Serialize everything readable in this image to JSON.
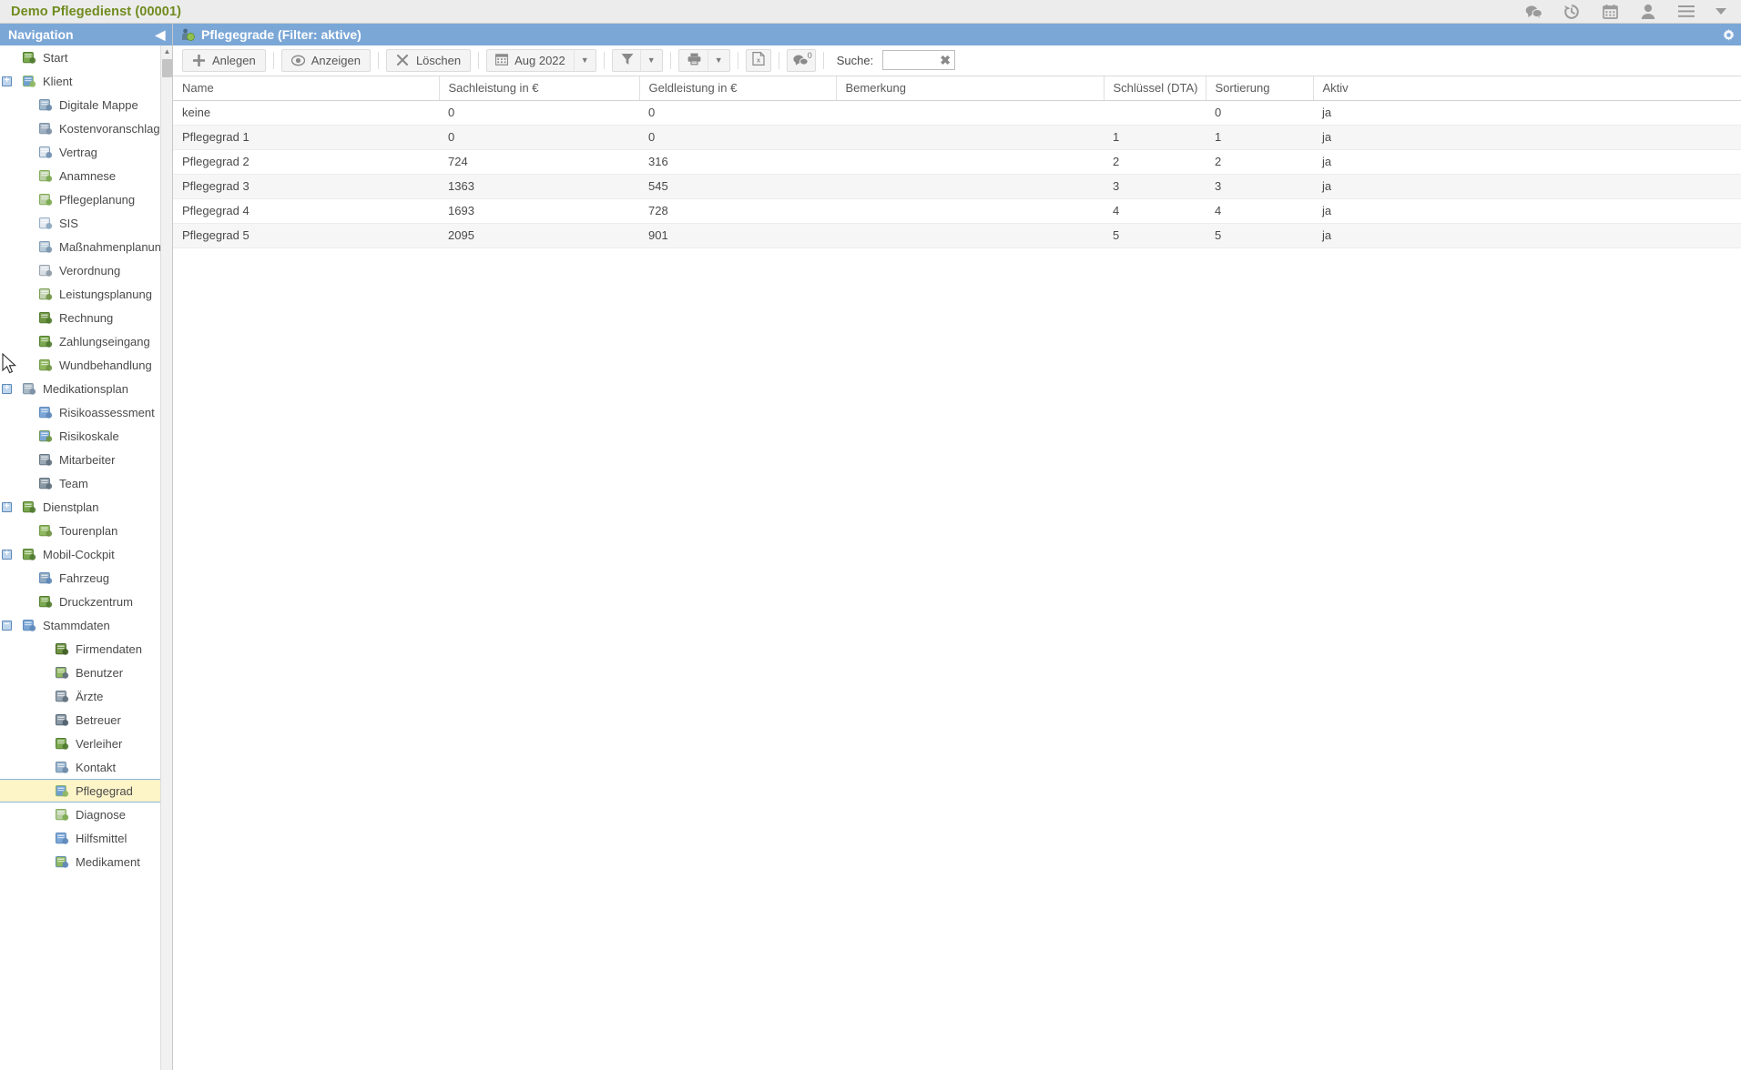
{
  "appbar": {
    "title": "Demo Pflegedienst (00001)",
    "icons": [
      {
        "name": "chat-icon",
        "glyph": "chat"
      },
      {
        "name": "history-icon",
        "glyph": "history"
      },
      {
        "name": "calendar-icon",
        "glyph": "calendar"
      },
      {
        "name": "user-icon",
        "glyph": "user"
      },
      {
        "name": "menu-icon",
        "glyph": "menu"
      },
      {
        "name": "dropdown-arrow-icon",
        "glyph": "caret"
      }
    ]
  },
  "sidebar": {
    "title": "Navigation",
    "collapse_glyph": "◀",
    "selected": "Pflegegrad",
    "items": [
      {
        "label": "Start",
        "indent": 0,
        "expander": "",
        "icon": "start-icon",
        "color": "#7aa84f",
        "color2": "#4f7a2f"
      },
      {
        "label": "Klient",
        "indent": 0,
        "expander": "+",
        "icon": "klient-icon",
        "color": "#6f9fd0",
        "color2": "#8fb85f"
      },
      {
        "label": "Digitale Mappe",
        "indent": 1,
        "expander": "",
        "icon": "digitale-mappe-icon",
        "color": "#9fb8cc",
        "color2": "#6b8aa8"
      },
      {
        "label": "Kostenvoranschlag",
        "indent": 1,
        "expander": "",
        "icon": "kostenvoranschlag-icon",
        "color": "#9fb0c0",
        "color2": "#7a8fa5"
      },
      {
        "label": "Vertrag",
        "indent": 1,
        "expander": "",
        "icon": "vertrag-icon",
        "color": "#dfe6ee",
        "color2": "#6f8fb0"
      },
      {
        "label": "Anamnese",
        "indent": 1,
        "expander": "",
        "icon": "anamnese-icon",
        "color": "#b9cfa3",
        "color2": "#7aa84f"
      },
      {
        "label": "Pflegeplanung",
        "indent": 1,
        "expander": "",
        "icon": "pflegeplanung-icon",
        "color": "#b9cfa3",
        "color2": "#7aa84f"
      },
      {
        "label": "SIS",
        "indent": 1,
        "expander": "",
        "icon": "sis-icon",
        "color": "#e4eaf0",
        "color2": "#8aa6bf"
      },
      {
        "label": "Maßnahmenplanung",
        "indent": 1,
        "expander": "",
        "icon": "massnahmenplanung-icon",
        "color": "#b6c9d8",
        "color2": "#7a96ae"
      },
      {
        "label": "Verordnung",
        "indent": 1,
        "expander": "",
        "icon": "verordnung-icon",
        "color": "#d8dee4",
        "color2": "#8c9aa6"
      },
      {
        "label": "Leistungsplanung",
        "indent": 1,
        "expander": "",
        "icon": "leistungsplanung-icon",
        "color": "#c3d3b3",
        "color2": "#6f9444"
      },
      {
        "label": "Rechnung",
        "indent": 1,
        "expander": "",
        "icon": "rechnung-icon",
        "color": "#6f9444",
        "color2": "#4f7a2f"
      },
      {
        "label": "Zahlungseingang",
        "indent": 1,
        "expander": "",
        "icon": "zahlungseingang-icon",
        "color": "#7aa84f",
        "color2": "#4f7a2f"
      },
      {
        "label": "Wundbehandlung",
        "indent": 1,
        "expander": "",
        "icon": "wundbehandlung-icon",
        "color": "#8fb85f",
        "color2": "#6f9444"
      },
      {
        "label": "Medikationsplan",
        "indent": 0,
        "expander": "+",
        "icon": "medikationsplan-icon",
        "color": "#a8b8c4",
        "color2": "#7a8fa5"
      },
      {
        "label": "Risikoassessment",
        "indent": 1,
        "expander": "",
        "icon": "risikoassessment-icon",
        "color": "#7ba7d7",
        "color2": "#5d87b8"
      },
      {
        "label": "Risikoskale",
        "indent": 1,
        "expander": "",
        "icon": "risikoskale-icon",
        "color": "#7ba7d7",
        "color2": "#6f9444"
      },
      {
        "label": "Mitarbeiter",
        "indent": 1,
        "expander": "",
        "icon": "mitarbeiter-icon",
        "color": "#9aa8b4",
        "color2": "#5f6f7c"
      },
      {
        "label": "Team",
        "indent": 1,
        "expander": "",
        "icon": "team-icon",
        "color": "#8a99a6",
        "color2": "#5f6f7c"
      },
      {
        "label": "Dienstplan",
        "indent": 0,
        "expander": "+",
        "icon": "dienstplan-icon",
        "color": "#7aa84f",
        "color2": "#4f7a2f"
      },
      {
        "label": "Tourenplan",
        "indent": 1,
        "expander": "",
        "icon": "tourenplan-icon",
        "color": "#8fb85f",
        "color2": "#6f9444"
      },
      {
        "label": "Mobil-Cockpit",
        "indent": 0,
        "expander": "+",
        "icon": "mobil-cockpit-icon",
        "color": "#7aa84f",
        "color2": "#4f7a2f"
      },
      {
        "label": "Fahrzeug",
        "indent": 1,
        "expander": "",
        "icon": "fahrzeug-icon",
        "color": "#8fa8c0",
        "color2": "#5d87b8"
      },
      {
        "label": "Druckzentrum",
        "indent": 1,
        "expander": "",
        "icon": "druckzentrum-icon",
        "color": "#7aa84f",
        "color2": "#4f7a2f"
      },
      {
        "label": "Stammdaten",
        "indent": 0,
        "expander": "−",
        "icon": "stammdaten-icon",
        "color": "#7ba7d7",
        "color2": "#5d87b8"
      },
      {
        "label": "Firmendaten",
        "indent": 2,
        "expander": "",
        "icon": "firmendaten-icon",
        "color": "#6f9444",
        "color2": "#3f5f24"
      },
      {
        "label": "Benutzer",
        "indent": 2,
        "expander": "",
        "icon": "benutzer-icon",
        "color": "#8fb85f",
        "color2": "#5f6f7c"
      },
      {
        "label": "Ärzte",
        "indent": 2,
        "expander": "",
        "icon": "aerzte-icon",
        "color": "#9aa8b4",
        "color2": "#5f6f7c"
      },
      {
        "label": "Betreuer",
        "indent": 2,
        "expander": "",
        "icon": "betreuer-icon",
        "color": "#8a99a6",
        "color2": "#4f5f6c"
      },
      {
        "label": "Verleiher",
        "indent": 2,
        "expander": "",
        "icon": "verleiher-icon",
        "color": "#7aa84f",
        "color2": "#4f7a2f"
      },
      {
        "label": "Kontakt",
        "indent": 2,
        "expander": "",
        "icon": "kontakt-icon",
        "color": "#9ab4cc",
        "color2": "#6b8aa8"
      },
      {
        "label": "Pflegegrad",
        "indent": 2,
        "expander": "",
        "icon": "pflegegrad-icon",
        "color": "#6f9fd0",
        "color2": "#8fb85f"
      },
      {
        "label": "Diagnose",
        "indent": 2,
        "expander": "",
        "icon": "diagnose-icon",
        "color": "#b9cfa3",
        "color2": "#7aa84f"
      },
      {
        "label": "Hilfsmittel",
        "indent": 2,
        "expander": "",
        "icon": "hilfsmittel-icon",
        "color": "#7ba7d7",
        "color2": "#5d87b8"
      },
      {
        "label": "Medikament",
        "indent": 2,
        "expander": "",
        "icon": "medikament-icon",
        "color": "#8fb85f",
        "color2": "#5d87b8"
      }
    ]
  },
  "panel": {
    "title": "Pflegegrade (Filter: aktive)",
    "icon": "pflegegrad-icon",
    "gear_icon": "gear-icon"
  },
  "toolbar": {
    "create_label": "Anlegen",
    "view_label": "Anzeigen",
    "delete_label": "Löschen",
    "period_label": "Aug 2022",
    "filter_icon": "filter-icon",
    "print_icon": "printer-icon",
    "excel_icon": "excel-export-icon",
    "comment_icon": "comment-icon",
    "comment_badge": "0",
    "search_label": "Suche:",
    "search_value": "",
    "search_placeholder": "",
    "clear_glyph": "✖"
  },
  "grid": {
    "columns": [
      "Name",
      "Sachleistung in €",
      "Geldleistung in €",
      "Bemerkung",
      "Schlüssel (DTA)",
      "Sortierung",
      "Aktiv"
    ],
    "rows": [
      {
        "name": "keine",
        "sachleistung": "0",
        "geldleistung": "0",
        "bemerkung": "",
        "schluessel": "",
        "sortierung": "0",
        "aktiv": "ja"
      },
      {
        "name": "Pflegegrad 1",
        "sachleistung": "0",
        "geldleistung": "0",
        "bemerkung": "",
        "schluessel": "1",
        "sortierung": "1",
        "aktiv": "ja"
      },
      {
        "name": "Pflegegrad 2",
        "sachleistung": "724",
        "geldleistung": "316",
        "bemerkung": "",
        "schluessel": "2",
        "sortierung": "2",
        "aktiv": "ja"
      },
      {
        "name": "Pflegegrad 3",
        "sachleistung": "1363",
        "geldleistung": "545",
        "bemerkung": "",
        "schluessel": "3",
        "sortierung": "3",
        "aktiv": "ja"
      },
      {
        "name": "Pflegegrad 4",
        "sachleistung": "1693",
        "geldleistung": "728",
        "bemerkung": "",
        "schluessel": "4",
        "sortierung": "4",
        "aktiv": "ja"
      },
      {
        "name": "Pflegegrad 5",
        "sachleistung": "2095",
        "geldleistung": "901",
        "bemerkung": "",
        "schluessel": "5",
        "sortierung": "5",
        "aktiv": "ja"
      }
    ]
  },
  "colors": {
    "header_blue": "#7ba7d7",
    "brand_green": "#6f8b1e",
    "selection_yellow": "#fdf4c8",
    "row_alt": "#f6f6f6"
  }
}
